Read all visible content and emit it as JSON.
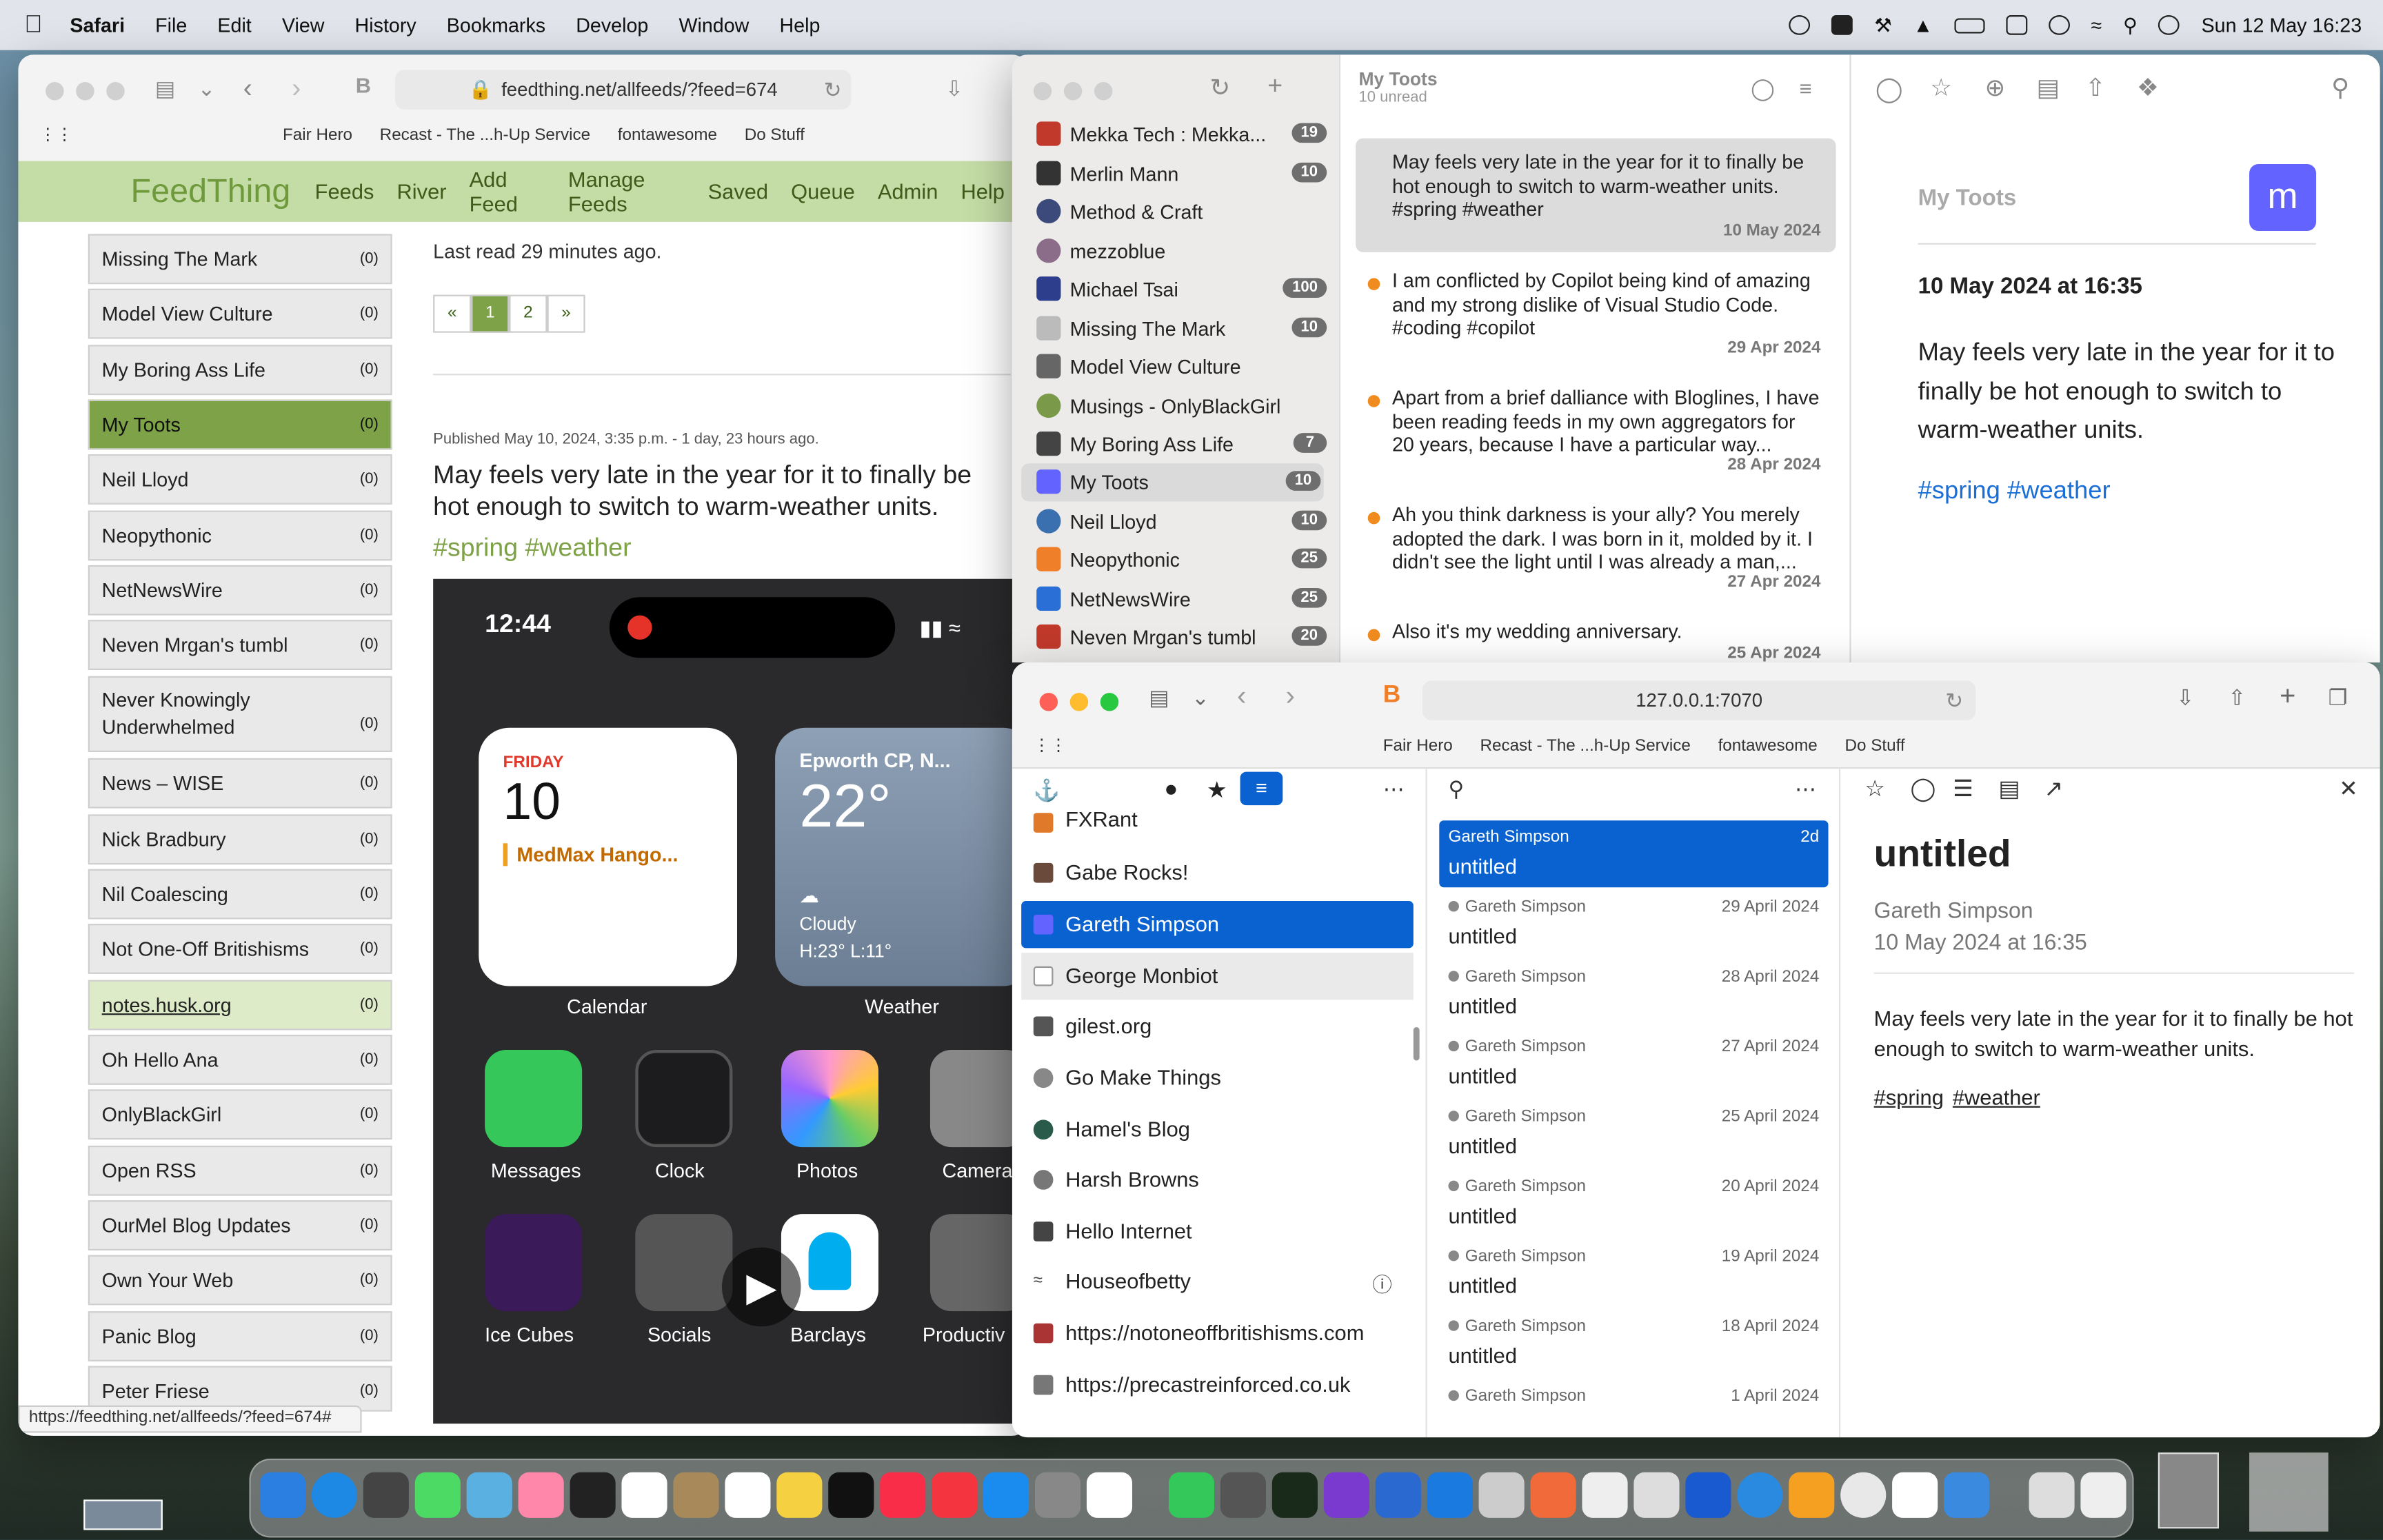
{
  "menubar": {
    "apple": "",
    "app": "Safari",
    "items": [
      "File",
      "Edit",
      "View",
      "History",
      "Bookmarks",
      "Develop",
      "Window",
      "Help"
    ],
    "clock": "Sun 12 May  16:23"
  },
  "window1": {
    "url": "feedthing.net/allfeeds/?feed=674",
    "favorites": [
      "Fair Hero",
      "Recast - The ...h-Up Service",
      "fontawesome",
      "Do Stuff"
    ],
    "brand": "FeedThing",
    "nav": [
      "Feeds",
      "River",
      "Add Feed",
      "Manage Feeds",
      "Saved",
      "Queue",
      "Admin",
      "Help"
    ],
    "feeds": [
      {
        "name": "Missing The Mark",
        "count": "(0)"
      },
      {
        "name": "Model View Culture",
        "count": "(0)"
      },
      {
        "name": "My Boring Ass Life",
        "count": "(0)"
      },
      {
        "name": "My Toots",
        "count": "(0)"
      },
      {
        "name": "Neil Lloyd",
        "count": "(0)"
      },
      {
        "name": "Neopythonic",
        "count": "(0)"
      },
      {
        "name": "NetNewsWire",
        "count": "(0)"
      },
      {
        "name": "Neven Mrgan's tumbl",
        "count": "(0)"
      },
      {
        "name": "Never Knowingly Underwhelmed",
        "count": "(0)"
      },
      {
        "name": "News – WISE",
        "count": "(0)"
      },
      {
        "name": "Nick Bradbury",
        "count": "(0)"
      },
      {
        "name": "Nil Coalescing",
        "count": "(0)"
      },
      {
        "name": "Not One-Off Britishisms",
        "count": "(0)"
      },
      {
        "name": "notes.husk.org",
        "count": "(0)"
      },
      {
        "name": "Oh Hello Ana",
        "count": "(0)"
      },
      {
        "name": "OnlyBlackGirl",
        "count": "(0)"
      },
      {
        "name": "Open RSS",
        "count": "(0)"
      },
      {
        "name": "OurMel Blog Updates",
        "count": "(0)"
      },
      {
        "name": "Own Your Web",
        "count": "(0)"
      },
      {
        "name": "Panic Blog",
        "count": "(0)"
      },
      {
        "name": "Peter Friese",
        "count": "(0)"
      }
    ],
    "last_read": "Last read 29 minutes ago.",
    "pager": [
      "«",
      "1",
      "2",
      "»"
    ],
    "published": "Published May 10, 2024, 3:35 p.m. - 1 day, 23 hours ago.",
    "post_text": "May feels very late in the year for it to finally be hot enough to switch to warm-weather units.",
    "post_tags": "#spring #weather",
    "phone": {
      "time": "12:44",
      "cal_day": "FRIDAY",
      "cal_date": "10",
      "cal_event": "MedMax Hango...",
      "weather_loc": "Epworth CP, N...",
      "weather_temp": "22°",
      "weather_desc": "Cloudy",
      "weather_hl": "H:23° L:11°",
      "widget_labels": [
        "Calendar",
        "Weather"
      ],
      "apps_row1": [
        "Messages",
        "Clock",
        "Photos",
        "Camera"
      ],
      "apps_row2": [
        "Ice Cubes",
        "Socials",
        "Barclays",
        "Productiv"
      ]
    },
    "status_url": "https://feedthing.net/allfeeds/?feed=674#"
  },
  "window2": {
    "title": "My Toots",
    "subtitle": "10 unread",
    "feeds": [
      {
        "name": "Mekka Tech : Mekka...",
        "badge": "19",
        "color": "#c0392b"
      },
      {
        "name": "Merlin Mann",
        "badge": "10",
        "color": "#333333"
      },
      {
        "name": "Method & Craft",
        "badge": "",
        "color": "#3b4a7a"
      },
      {
        "name": "mezzoblue",
        "badge": "",
        "color": "#8b6d8a"
      },
      {
        "name": "Michael Tsai",
        "badge": "100",
        "color": "#2d3e8c"
      },
      {
        "name": "Missing The Mark",
        "badge": "10",
        "color": "#bbbbbb"
      },
      {
        "name": "Model View Culture",
        "badge": "",
        "color": "#666666"
      },
      {
        "name": "Musings - OnlyBlackGirl",
        "badge": "",
        "color": "#7a9a4a"
      },
      {
        "name": "My Boring Ass Life",
        "badge": "7",
        "color": "#444444"
      },
      {
        "name": "My Toots",
        "badge": "10",
        "color": "#6364ff"
      },
      {
        "name": "Neil Lloyd",
        "badge": "10",
        "color": "#3a6fb0"
      },
      {
        "name": "Neopythonic",
        "badge": "25",
        "color": "#f07f2a"
      },
      {
        "name": "NetNewsWire",
        "badge": "25",
        "color": "#2a6fd6"
      },
      {
        "name": "Neven Mrgan's tumbl",
        "badge": "20",
        "color": "#c0392b"
      }
    ],
    "articles": [
      {
        "text": "May feels very late in the year for it to finally be hot enough to switch to warm-weather units. #spring #weather",
        "date": "10 May 2024",
        "selected": true
      },
      {
        "text": "I am conflicted by Copilot being kind of amazing and my strong dislike of Visual Studio Code. #coding #copilot",
        "date": "29 Apr 2024"
      },
      {
        "text": "Apart from a brief dalliance with Bloglines, I have been reading feeds in my own aggregators for 20 years, because I have a particular way...",
        "date": "28 Apr 2024"
      },
      {
        "text": "Ah you think darkness is your ally? You merely adopted the dark. I was born in it, molded by it. I didn't see the light until I was already a man,...",
        "date": "27 Apr 2024"
      },
      {
        "text": "Also it's my wedding anniversary.",
        "date": "25 Apr 2024"
      }
    ],
    "detail": {
      "feed": "My Toots",
      "datetime": "10 May 2024 at 16:35",
      "body": "May feels very late in the year for it to finally be hot enough to switch to warm-weather units.",
      "tags": "#spring #weather"
    }
  },
  "window3": {
    "url": "127.0.0.1:7070",
    "favorites": [
      "Fair Hero",
      "Recast - The ...h-Up Service",
      "fontawesome",
      "Do Stuff"
    ],
    "sources": [
      "FXRant",
      "Gabe Rocks!",
      "Gareth Simpson",
      "George Monbiot",
      "gilest.org",
      "Go Make Things",
      "Hamel's Blog",
      "Harsh Browns",
      "Hello Internet",
      "Houseofbetty",
      "https://notoneoffbritishisms.com",
      "https://precastreinforced.co.uk"
    ],
    "items": [
      {
        "author": "Gareth Simpson",
        "date": "2d",
        "title": "untitled"
      },
      {
        "author": "Gareth Simpson",
        "date": "29 April 2024",
        "title": "untitled"
      },
      {
        "author": "Gareth Simpson",
        "date": "28 April 2024",
        "title": "untitled"
      },
      {
        "author": "Gareth Simpson",
        "date": "27 April 2024",
        "title": "untitled"
      },
      {
        "author": "Gareth Simpson",
        "date": "25 April 2024",
        "title": "untitled"
      },
      {
        "author": "Gareth Simpson",
        "date": "20 April 2024",
        "title": "untitled"
      },
      {
        "author": "Gareth Simpson",
        "date": "19 April 2024",
        "title": "untitled"
      },
      {
        "author": "Gareth Simpson",
        "date": "18 April 2024",
        "title": "untitled"
      },
      {
        "author": "Gareth Simpson",
        "date": "1 April 2024",
        "title": ""
      }
    ],
    "detail": {
      "title": "untitled",
      "author": "Gareth Simpson",
      "datetime": "10 May 2024 at 16:35",
      "body": "May feels very late in the year for it to finally be hot enough to switch to warm-weather units.",
      "tag1": "#spring",
      "tag2": "#weather"
    }
  },
  "colors": {
    "accent_blue": "#0a62d0",
    "feedthing_green": "#7ea247",
    "mastodon": "#6364ff",
    "unread_dot": "#f08c1f"
  }
}
